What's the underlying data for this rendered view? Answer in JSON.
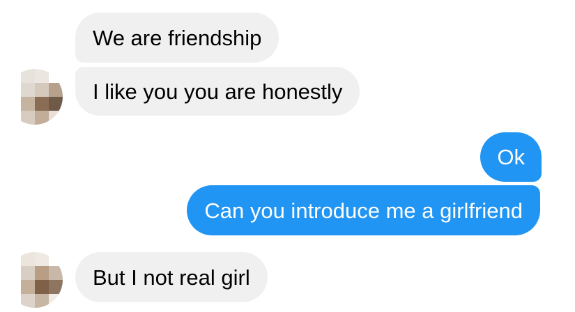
{
  "messages": [
    {
      "from": "them",
      "text": "We are friendship"
    },
    {
      "from": "them",
      "text": "I like you you are honestly"
    },
    {
      "from": "me",
      "text": "Ok"
    },
    {
      "from": "me",
      "text": "Can you introduce me a girlfriend"
    },
    {
      "from": "them",
      "text": "But I not real girl"
    }
  ],
  "colors": {
    "incoming_bubble": "#f0f0f0",
    "outgoing_bubble": "#2195f3",
    "incoming_text": "#000000",
    "outgoing_text": "#ffffff"
  },
  "avatars": [
    {
      "icon": "pixelated-avatar-icon"
    },
    {
      "icon": "pixelated-avatar-icon"
    }
  ]
}
